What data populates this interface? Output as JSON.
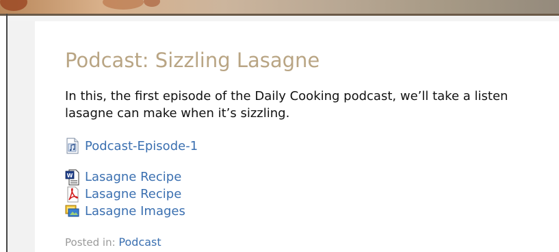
{
  "post": {
    "title": "Podcast: Sizzling Lasagne",
    "body_line1": "In this, the first episode of the Daily Cooking podcast, we’ll take a listen",
    "body_line2": "lasagne can make when it’s sizzling."
  },
  "episode_link": {
    "label": "Podcast-Episode-1",
    "icon": "audio-file-icon"
  },
  "attachments": [
    {
      "label": "Lasagne Recipe",
      "icon": "word-document-icon"
    },
    {
      "label": "Lasagne Recipe",
      "icon": "pdf-document-icon"
    },
    {
      "label": "Lasagne Images",
      "icon": "image-gallery-icon"
    }
  ],
  "meta": {
    "posted_in_label": "Posted in:",
    "category": "Podcast"
  },
  "colors": {
    "title": "#b9a584",
    "link": "#3a6fb0",
    "meta": "#9a9a9a"
  }
}
